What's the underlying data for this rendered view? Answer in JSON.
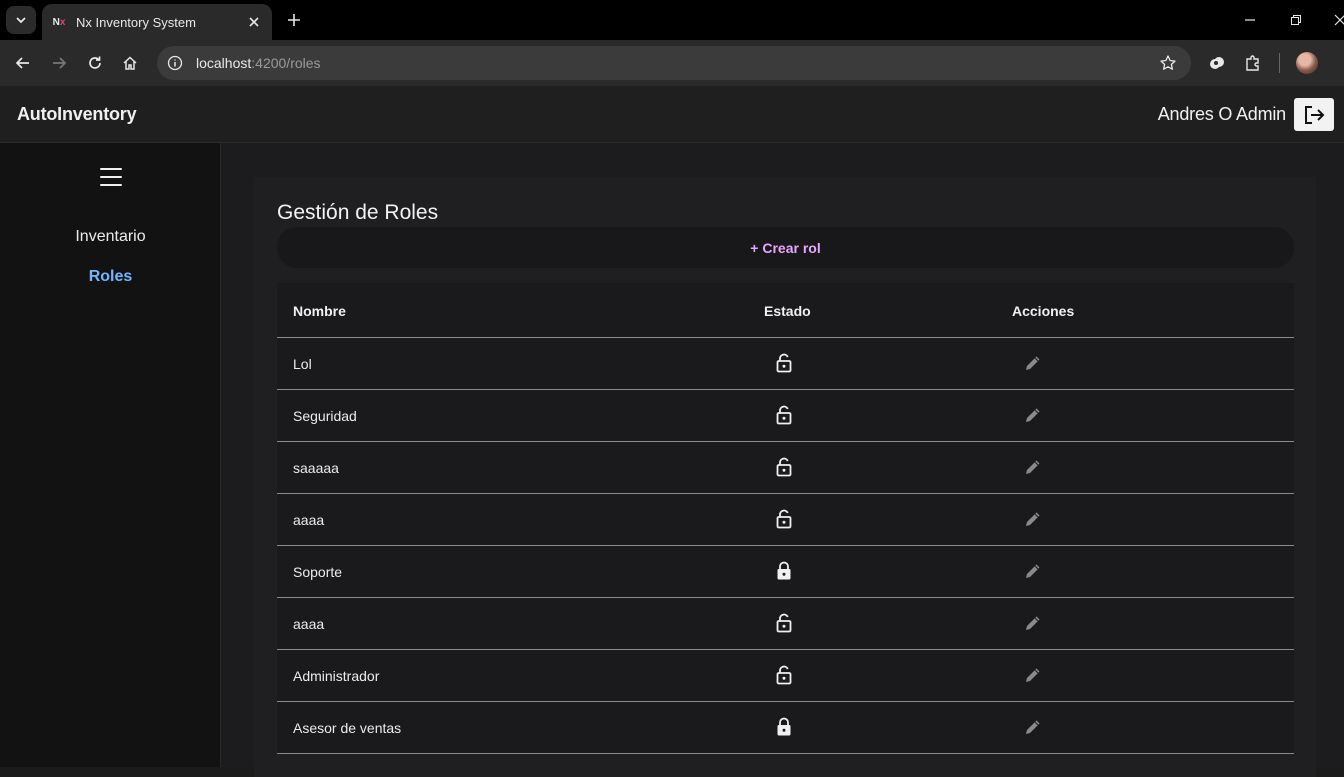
{
  "browser": {
    "tab_title": "Nx Inventory System",
    "favicon_text": "N",
    "favicon_accent": "x",
    "url_host": "localhost",
    "url_path": ":4200/roles"
  },
  "header": {
    "brand": "AutoInventory",
    "user": "Andres O Admin"
  },
  "sidebar": {
    "items": [
      {
        "label": "Inventario"
      },
      {
        "label": "Roles"
      }
    ]
  },
  "main": {
    "title": "Gestión de Roles",
    "create_label": "+ Crear rol",
    "columns": [
      "Nombre",
      "Estado",
      "Acciones"
    ],
    "rows": [
      {
        "name": "Lol",
        "status": "unlocked"
      },
      {
        "name": "Seguridad",
        "status": "unlocked"
      },
      {
        "name": "saaaaa",
        "status": "unlocked"
      },
      {
        "name": "aaaa",
        "status": "unlocked"
      },
      {
        "name": "Soporte",
        "status": "locked"
      },
      {
        "name": "aaaa",
        "status": "unlocked"
      },
      {
        "name": "Administrador",
        "status": "unlocked"
      },
      {
        "name": "Asesor de ventas",
        "status": "locked"
      }
    ]
  },
  "colors": {
    "accent_link": "#6fb6ff",
    "create_text": "#e8a6ff"
  }
}
